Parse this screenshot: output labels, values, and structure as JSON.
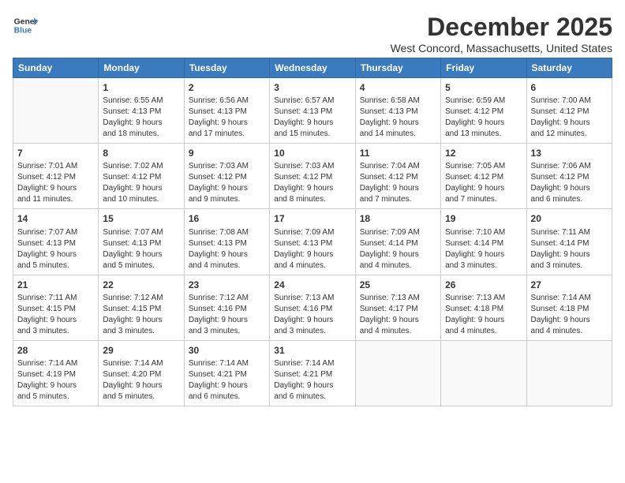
{
  "header": {
    "logo_line1": "General",
    "logo_line2": "Blue",
    "month": "December 2025",
    "location": "West Concord, Massachusetts, United States"
  },
  "weekdays": [
    "Sunday",
    "Monday",
    "Tuesday",
    "Wednesday",
    "Thursday",
    "Friday",
    "Saturday"
  ],
  "weeks": [
    [
      {
        "day": "",
        "info": ""
      },
      {
        "day": "1",
        "info": "Sunrise: 6:55 AM\nSunset: 4:13 PM\nDaylight: 9 hours\nand 18 minutes."
      },
      {
        "day": "2",
        "info": "Sunrise: 6:56 AM\nSunset: 4:13 PM\nDaylight: 9 hours\nand 17 minutes."
      },
      {
        "day": "3",
        "info": "Sunrise: 6:57 AM\nSunset: 4:13 PM\nDaylight: 9 hours\nand 15 minutes."
      },
      {
        "day": "4",
        "info": "Sunrise: 6:58 AM\nSunset: 4:13 PM\nDaylight: 9 hours\nand 14 minutes."
      },
      {
        "day": "5",
        "info": "Sunrise: 6:59 AM\nSunset: 4:12 PM\nDaylight: 9 hours\nand 13 minutes."
      },
      {
        "day": "6",
        "info": "Sunrise: 7:00 AM\nSunset: 4:12 PM\nDaylight: 9 hours\nand 12 minutes."
      }
    ],
    [
      {
        "day": "7",
        "info": "Sunrise: 7:01 AM\nSunset: 4:12 PM\nDaylight: 9 hours\nand 11 minutes."
      },
      {
        "day": "8",
        "info": "Sunrise: 7:02 AM\nSunset: 4:12 PM\nDaylight: 9 hours\nand 10 minutes."
      },
      {
        "day": "9",
        "info": "Sunrise: 7:03 AM\nSunset: 4:12 PM\nDaylight: 9 hours\nand 9 minutes."
      },
      {
        "day": "10",
        "info": "Sunrise: 7:03 AM\nSunset: 4:12 PM\nDaylight: 9 hours\nand 8 minutes."
      },
      {
        "day": "11",
        "info": "Sunrise: 7:04 AM\nSunset: 4:12 PM\nDaylight: 9 hours\nand 7 minutes."
      },
      {
        "day": "12",
        "info": "Sunrise: 7:05 AM\nSunset: 4:12 PM\nDaylight: 9 hours\nand 7 minutes."
      },
      {
        "day": "13",
        "info": "Sunrise: 7:06 AM\nSunset: 4:12 PM\nDaylight: 9 hours\nand 6 minutes."
      }
    ],
    [
      {
        "day": "14",
        "info": "Sunrise: 7:07 AM\nSunset: 4:13 PM\nDaylight: 9 hours\nand 5 minutes."
      },
      {
        "day": "15",
        "info": "Sunrise: 7:07 AM\nSunset: 4:13 PM\nDaylight: 9 hours\nand 5 minutes."
      },
      {
        "day": "16",
        "info": "Sunrise: 7:08 AM\nSunset: 4:13 PM\nDaylight: 9 hours\nand 4 minutes."
      },
      {
        "day": "17",
        "info": "Sunrise: 7:09 AM\nSunset: 4:13 PM\nDaylight: 9 hours\nand 4 minutes."
      },
      {
        "day": "18",
        "info": "Sunrise: 7:09 AM\nSunset: 4:14 PM\nDaylight: 9 hours\nand 4 minutes."
      },
      {
        "day": "19",
        "info": "Sunrise: 7:10 AM\nSunset: 4:14 PM\nDaylight: 9 hours\nand 3 minutes."
      },
      {
        "day": "20",
        "info": "Sunrise: 7:11 AM\nSunset: 4:14 PM\nDaylight: 9 hours\nand 3 minutes."
      }
    ],
    [
      {
        "day": "21",
        "info": "Sunrise: 7:11 AM\nSunset: 4:15 PM\nDaylight: 9 hours\nand 3 minutes."
      },
      {
        "day": "22",
        "info": "Sunrise: 7:12 AM\nSunset: 4:15 PM\nDaylight: 9 hours\nand 3 minutes."
      },
      {
        "day": "23",
        "info": "Sunrise: 7:12 AM\nSunset: 4:16 PM\nDaylight: 9 hours\nand 3 minutes."
      },
      {
        "day": "24",
        "info": "Sunrise: 7:13 AM\nSunset: 4:16 PM\nDaylight: 9 hours\nand 3 minutes."
      },
      {
        "day": "25",
        "info": "Sunrise: 7:13 AM\nSunset: 4:17 PM\nDaylight: 9 hours\nand 4 minutes."
      },
      {
        "day": "26",
        "info": "Sunrise: 7:13 AM\nSunset: 4:18 PM\nDaylight: 9 hours\nand 4 minutes."
      },
      {
        "day": "27",
        "info": "Sunrise: 7:14 AM\nSunset: 4:18 PM\nDaylight: 9 hours\nand 4 minutes."
      }
    ],
    [
      {
        "day": "28",
        "info": "Sunrise: 7:14 AM\nSunset: 4:19 PM\nDaylight: 9 hours\nand 5 minutes."
      },
      {
        "day": "29",
        "info": "Sunrise: 7:14 AM\nSunset: 4:20 PM\nDaylight: 9 hours\nand 5 minutes."
      },
      {
        "day": "30",
        "info": "Sunrise: 7:14 AM\nSunset: 4:21 PM\nDaylight: 9 hours\nand 6 minutes."
      },
      {
        "day": "31",
        "info": "Sunrise: 7:14 AM\nSunset: 4:21 PM\nDaylight: 9 hours\nand 6 minutes."
      },
      {
        "day": "",
        "info": ""
      },
      {
        "day": "",
        "info": ""
      },
      {
        "day": "",
        "info": ""
      }
    ]
  ]
}
